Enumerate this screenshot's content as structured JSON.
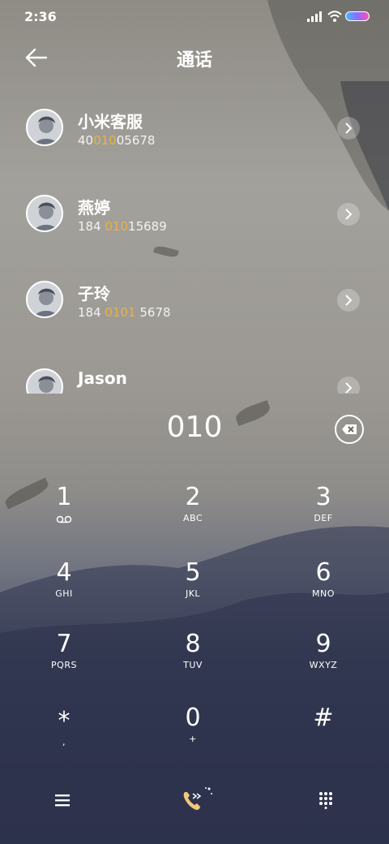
{
  "status_bar": {
    "time": "2:36"
  },
  "header": {
    "title": "通话"
  },
  "contacts": [
    {
      "name": "小米客服",
      "number_pre": "40",
      "number_match": "010",
      "number_post": "05678"
    },
    {
      "name": "燕婷",
      "number_pre": "184 ",
      "number_match": "010",
      "number_post": "15689"
    },
    {
      "name": "子玲",
      "number_pre": "184 ",
      "number_match": "0101",
      "number_post": " 5678"
    },
    {
      "name": "Jason",
      "number_pre": "",
      "number_match": "",
      "number_post": ""
    }
  ],
  "dialer": {
    "typed_number": "010"
  },
  "keypad": [
    {
      "digit": "1",
      "letters": ""
    },
    {
      "digit": "2",
      "letters": "ABC"
    },
    {
      "digit": "3",
      "letters": "DEF"
    },
    {
      "digit": "4",
      "letters": "GHI"
    },
    {
      "digit": "5",
      "letters": "JKL"
    },
    {
      "digit": "6",
      "letters": "MNO"
    },
    {
      "digit": "7",
      "letters": "PQRS"
    },
    {
      "digit": "8",
      "letters": "TUV"
    },
    {
      "digit": "9",
      "letters": "WXYZ"
    },
    {
      "digit": "*",
      "letters": ","
    },
    {
      "digit": "0",
      "letters": "+"
    },
    {
      "digit": "#",
      "letters": ""
    }
  ],
  "colors": {
    "match_highlight": "#e6b24a"
  },
  "icons": {
    "back": "arrow-left-icon",
    "delete": "backspace-icon",
    "menu": "menu-icon",
    "call": "call-icon",
    "dialpad": "dialpad-icon",
    "voicemail": "voicemail-icon"
  }
}
